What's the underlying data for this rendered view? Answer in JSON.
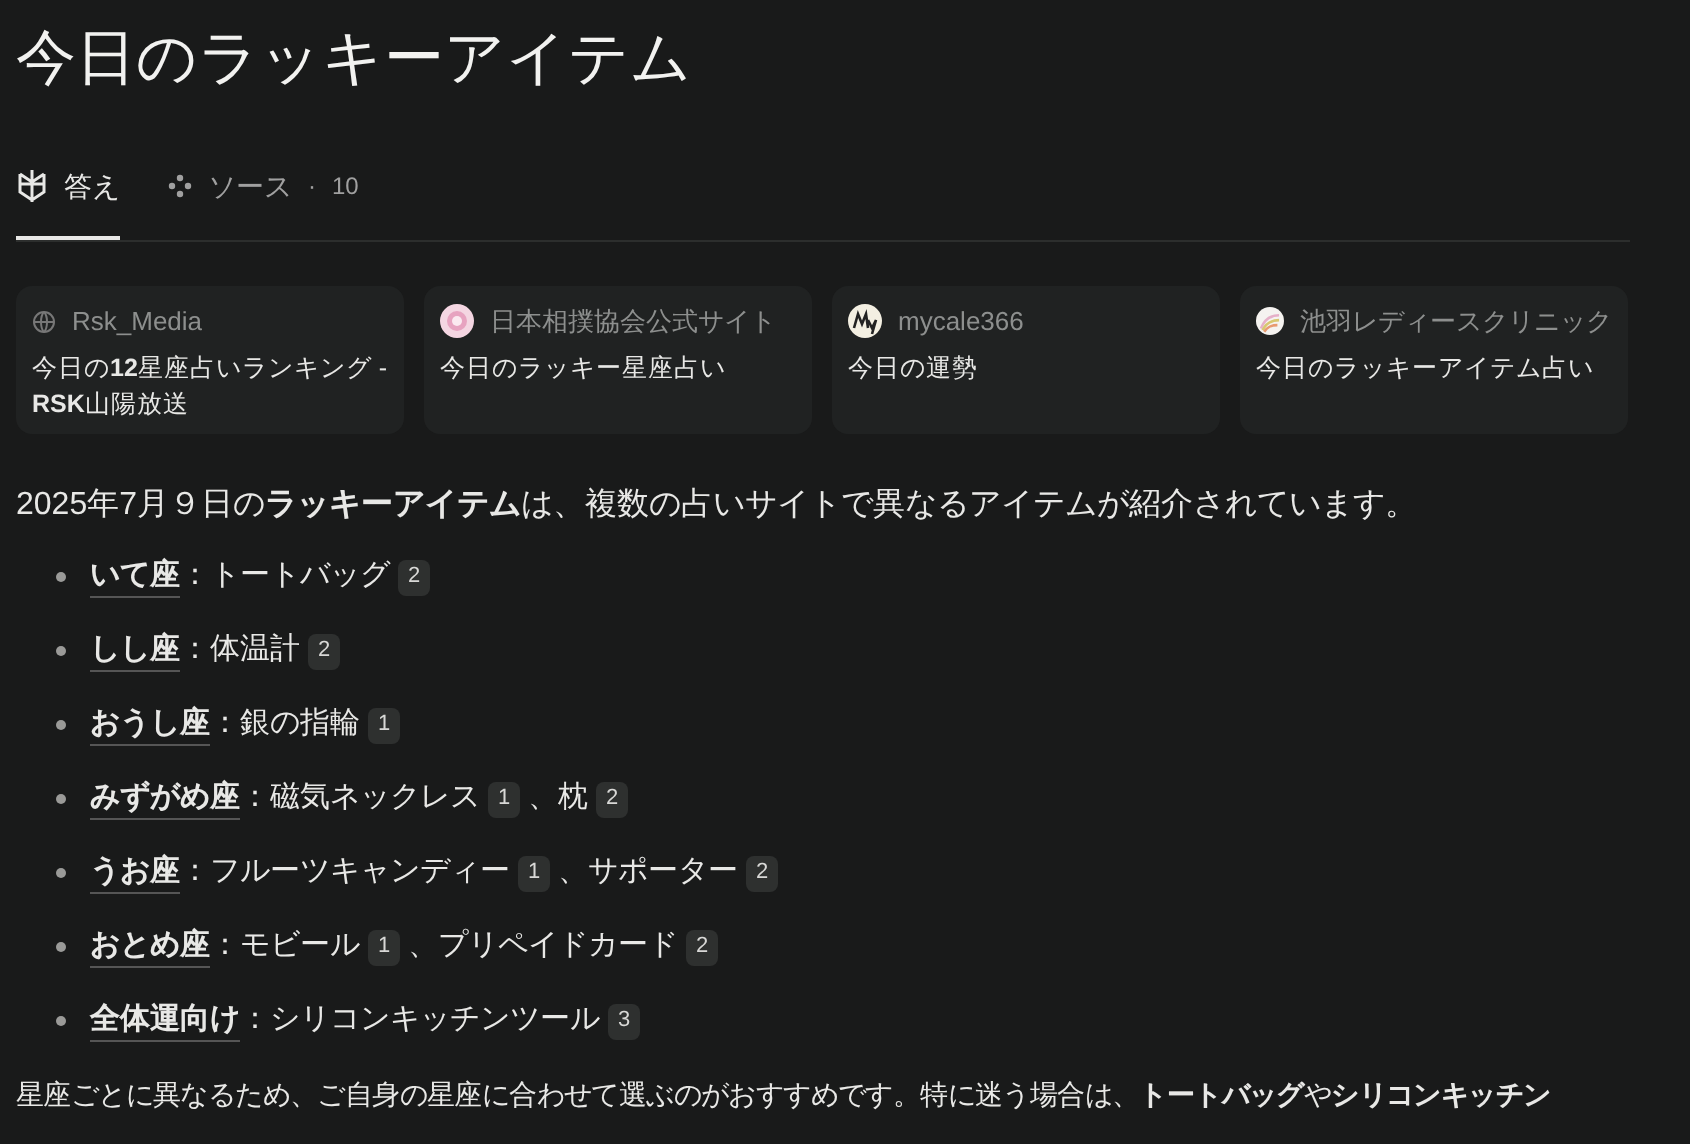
{
  "title": "今日のラッキーアイテム",
  "tabs": [
    {
      "kind": "answer",
      "label": "答え",
      "selected": true
    },
    {
      "kind": "sources",
      "label": "ソース",
      "sep": "·",
      "count": "10",
      "selected": false
    }
  ],
  "sources": [
    {
      "kind": "globe",
      "site": "Rsk_Media",
      "title": "今日の**12**星座占いランキング - **RSK**山陽放送"
    },
    {
      "kind": "sumo",
      "site": "日本相撲協会公式サイト",
      "title": "今日のラッキー星座占い"
    },
    {
      "kind": "my",
      "site": "mycale366",
      "title": "今日の運勢"
    },
    {
      "kind": "clinic",
      "site": "池羽レディースクリニック",
      "title": "今日のラッキーアイテム占い"
    }
  ],
  "intro": "2025年7月９日の**ラッキーアイテム**は、複数の占いサイトで異なるアイテムが紹介されています。",
  "items": [
    {
      "label": "いて座",
      "entries": [
        {
          "text": "：トートバッグ",
          "cite": "2"
        }
      ]
    },
    {
      "label": "しし座",
      "entries": [
        {
          "text": "：体温計",
          "cite": "2"
        }
      ]
    },
    {
      "label": "おうし座",
      "entries": [
        {
          "text": "：銀の指輪",
          "cite": "1"
        }
      ]
    },
    {
      "label": "みずがめ座",
      "entries": [
        {
          "text": "：磁気ネックレス",
          "cite": "1"
        },
        {
          "text": "、枕",
          "cite": "2"
        }
      ]
    },
    {
      "label": "うお座",
      "entries": [
        {
          "text": "：フルーツキャンディー",
          "cite": "1"
        },
        {
          "text": "、サポーター",
          "cite": "2"
        }
      ]
    },
    {
      "label": "おとめ座",
      "entries": [
        {
          "text": "：モビール",
          "cite": "1"
        },
        {
          "text": "、プリペイドカード",
          "cite": "2"
        }
      ]
    },
    {
      "label": "全体運向け",
      "entries": [
        {
          "text": "：シリコンキッチンツール",
          "cite": "3"
        }
      ]
    }
  ],
  "closing": "星座ごとに異なるため、ご自身の星座に合わせて選ぶのがおすすめです。特に迷う場合は、**トートバッグ**や**シリコンキッチン**"
}
